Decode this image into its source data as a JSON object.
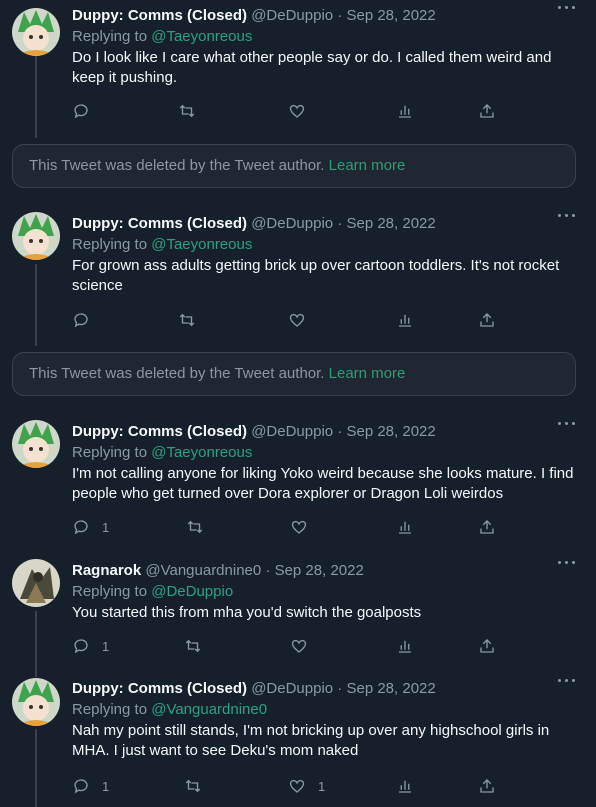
{
  "colors": {
    "background": "#15202b",
    "accent": "#2f9e72",
    "muted": "#8b98a5",
    "border": "#38444d"
  },
  "tweets": [
    {
      "name": "Duppy: Comms (Closed)",
      "handle": "@DeDuppio",
      "date": "Sep 28, 2022",
      "replying_label": "Replying to",
      "replying_to": "@Taeyonreous",
      "text_lines": [
        "Do I look like I care what other people say or do. I called them weird and",
        "keep it pushing."
      ],
      "reply_count": "",
      "like_count": ""
    },
    {
      "name": "Duppy: Comms (Closed)",
      "handle": "@DeDuppio",
      "date": "Sep 28, 2022",
      "replying_label": "Replying to",
      "replying_to": "@Taeyonreous",
      "text_lines": [
        "For grown ass adults getting brick up over cartoon toddlers. It's not rocket",
        "science"
      ],
      "reply_count": "",
      "like_count": ""
    },
    {
      "name": "Duppy: Comms (Closed)",
      "handle": "@DeDuppio",
      "date": "Sep 28, 2022",
      "replying_label": "Replying to",
      "replying_to": "@Taeyonreous",
      "text_lines": [
        "I'm not calling anyone for liking Yoko weird because she looks mature. I find",
        "people who get turned over Dora explorer or Dragon Loli weirdos"
      ],
      "reply_count": "1",
      "like_count": ""
    },
    {
      "name": "Ragnarok",
      "handle": "@Vanguardnine0",
      "date": "Sep 28, 2022",
      "replying_label": "Replying to",
      "replying_to": "@DeDuppio",
      "text_lines": [
        "You started this from mha you'd switch the goalposts"
      ],
      "reply_count": "1",
      "like_count": ""
    },
    {
      "name": "Duppy: Comms (Closed)",
      "handle": "@DeDuppio",
      "date": "Sep 28, 2022",
      "replying_label": "Replying to",
      "replying_to": "@Vanguardnine0",
      "text_lines": [
        "Nah my point still stands, I'm not bricking up over any highschool girls in",
        "MHA. I just want to see Deku's mom naked"
      ],
      "reply_count": "1",
      "like_count": "1"
    }
  ],
  "deleted_notice": {
    "text": "This Tweet was deleted by the Tweet author.",
    "link": "Learn more"
  },
  "separator": "·"
}
